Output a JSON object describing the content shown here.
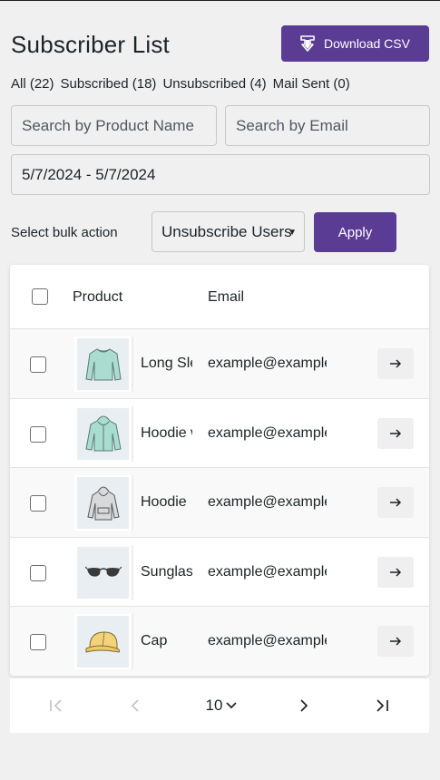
{
  "header": {
    "title": "Subscriber List",
    "download_label": "Download CSV"
  },
  "filters": [
    {
      "label": "All",
      "count": "(22)"
    },
    {
      "label": "Subscribed",
      "count": "(18)"
    },
    {
      "label": "Unsubscribed",
      "count": "(4)"
    },
    {
      "label": "Mail Sent",
      "count": "(0)"
    }
  ],
  "search": {
    "product_placeholder": "Search by Product Name",
    "email_placeholder": "Search by Email",
    "date_range": "5/7/2024 - 5/7/2024"
  },
  "bulk": {
    "label": "Select bulk action",
    "selected": "Unsubscribe Users",
    "apply_label": "Apply"
  },
  "table": {
    "columns": [
      "Product",
      "Email"
    ],
    "rows": [
      {
        "product": "Long Sleeve Tee",
        "email": "example@example.com",
        "thumb": "long-sleeve-icon"
      },
      {
        "product": "Hoodie with Zipper",
        "email": "example@example.com",
        "thumb": "zip-hoodie-icon"
      },
      {
        "product": "Hoodie",
        "email": "example@example.com",
        "thumb": "hoodie-icon"
      },
      {
        "product": "Sunglasses",
        "email": "example@example.com",
        "thumb": "sunglasses-icon"
      },
      {
        "product": "Cap",
        "email": "example@example.com",
        "thumb": "cap-icon"
      }
    ]
  },
  "pagination": {
    "page_size": "10"
  },
  "colors": {
    "accent": "#5b3c95",
    "background": "#f0f0f1"
  }
}
